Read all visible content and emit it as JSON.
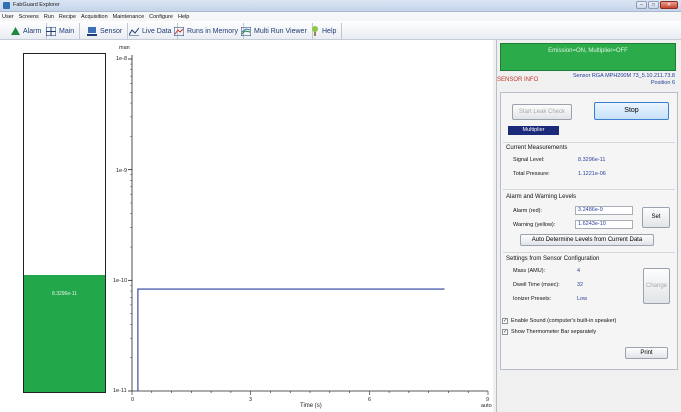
{
  "window": {
    "title": "FabGuard Explorer"
  },
  "menu": [
    "User",
    "Screens",
    "Run",
    "Recipe",
    "Acquisition",
    "Maintenance",
    "Configure",
    "Help"
  ],
  "toolbar": {
    "tabs": [
      {
        "label": "Alarm",
        "icon": "alarm-triangle-icon"
      },
      {
        "label": "Main",
        "icon": "main-icon"
      },
      {
        "label": "Sensor",
        "icon": "sensor-icon"
      },
      {
        "label": "Live Data",
        "icon": "live-data-icon"
      },
      {
        "label": "Runs in Memory",
        "icon": "runs-memory-icon"
      },
      {
        "label": "Multi Run Viewer",
        "icon": "multi-run-icon"
      },
      {
        "label": "Help",
        "icon": "help-icon"
      }
    ]
  },
  "plot": {
    "y_unit": "man",
    "thermometer_value": "8.3296e-11",
    "y_ticks": [
      "1e-8",
      "1e-9",
      "1e-10",
      "1e-11"
    ],
    "x_ticks": [
      "0",
      "3",
      "6",
      "9"
    ],
    "x_title": "Time (s)",
    "x_scale_mode": "auto"
  },
  "chart_data": {
    "type": "line",
    "xlabel": "Time (s)",
    "ylabel": "",
    "y_scale": "log",
    "xlim": [
      0,
      9
    ],
    "ylim": [
      1e-11,
      1e-08
    ],
    "series": [
      {
        "x": [
          0.15,
          0.15,
          0.25,
          7.9
        ],
        "y": [
          1e-11,
          8.3296e-11,
          8.3296e-11,
          8.3296e-11
        ]
      }
    ],
    "color": "#2a3f9c"
  },
  "panel": {
    "status": "Emission=ON, Multiplier=OFF",
    "sensor_info_label": "SENSOR INFO",
    "sensor_desc_line1": "Sensor RGA MPH200M 73_5.10.211.73.8",
    "sensor_desc_line2": "Position 6",
    "start_leak_check": "Start Leak Check",
    "stop": "Stop",
    "multiplier": "Multiplier",
    "current_measurements": {
      "title": "Current Measurements",
      "signal_label": "Signal Level:",
      "signal_value": "8.3296e-11",
      "pressure_label": "Total Pressure:",
      "pressure_value": "1.1221e-06"
    },
    "alarm_levels": {
      "title": "Alarm and Warning Levels",
      "alarm_label": "Alarm (red):",
      "alarm_value": "3.2486e-9",
      "warning_label": "Warning (yellow):",
      "warning_value": "1.6243e-10",
      "set_button": "Set",
      "auto_button": "Auto Determine Levels from Current Data"
    },
    "sensor_config": {
      "title": "Settings from Sensor Configuration",
      "mass_label": "Mass (AMU):",
      "mass_value": "4",
      "dwell_label": "Dwell Time (msec):",
      "dwell_value": "32",
      "ionizer_label": "Ionizer Presets:",
      "ionizer_value": "Low",
      "change_button": "Change"
    },
    "enable_sound": "Enable Sound (computer's built-in speaker)",
    "show_thermo": "Show Thermometer Bar separately",
    "print_button": "Print"
  },
  "colors": {
    "status_green": "#2bab4a",
    "thermo_green": "#22a74a",
    "line_blue": "#2a3f9c",
    "sensor_red": "#c0392b"
  }
}
